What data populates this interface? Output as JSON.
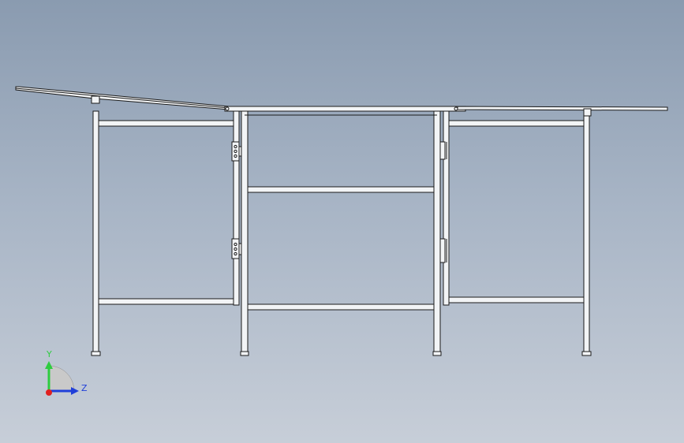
{
  "viewport": {
    "background_top": "#8a9bb0",
    "background_bottom": "#c7ced8"
  },
  "model": {
    "description_icon": "table-frame-cad-model"
  },
  "triad": {
    "y_label": "Y",
    "z_label": "Z",
    "y_color": "#2ecc40",
    "z_color": "#1f3fd9",
    "x_color": "#e02020"
  }
}
